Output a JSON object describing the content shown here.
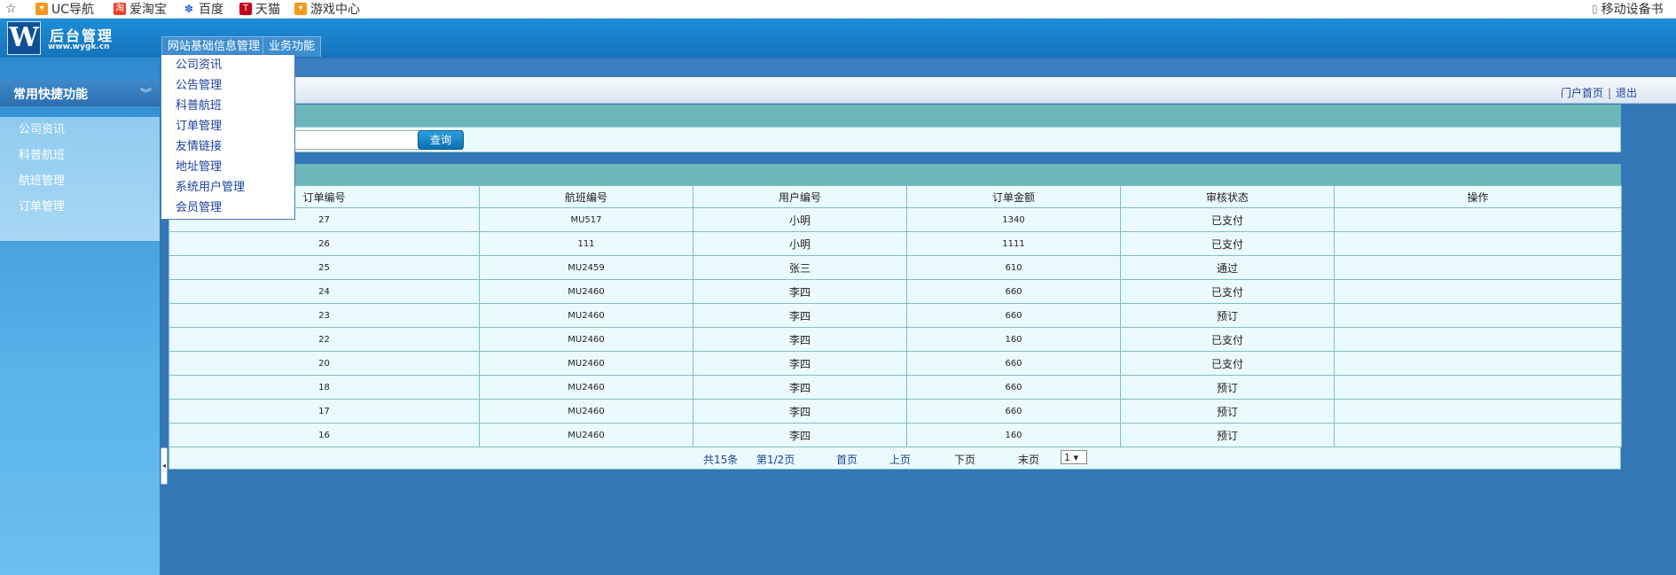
{
  "bookmarks": [
    {
      "label": "UC导航",
      "icon": "uc-icon",
      "color": "#f39a1e"
    },
    {
      "label": "爱淘宝",
      "icon": "taobao-icon",
      "color": "#e8412a"
    },
    {
      "label": "百度",
      "icon": "baidu-paw-icon",
      "color": "#2d6be0"
    },
    {
      "label": "天猫",
      "icon": "tmall-icon",
      "color": "#c4001a"
    },
    {
      "label": "游戏中心",
      "icon": "game-icon",
      "color": "#f39a1e"
    }
  ],
  "mobile_label": "移动设备书",
  "header": {
    "logo_letter": "W",
    "title": "后台管理",
    "url": "www.wygk.cn",
    "tabs": [
      "网站基础信息管理",
      "业务功能"
    ]
  },
  "dropdown": [
    "公司资讯",
    "公告管理",
    "科普航班",
    "订单管理",
    "友情链接",
    "地址管理",
    "系统用户管理",
    "会员管理"
  ],
  "sidebar": {
    "title": "常用快捷功能",
    "items": [
      "公司资讯",
      "科普航班",
      "航班管理",
      "订单管理"
    ]
  },
  "top_links": {
    "home": "门户首页",
    "sep": "|",
    "logout": "退出"
  },
  "search": {
    "button": "查询",
    "value": ""
  },
  "table": {
    "headers": [
      "订单编号",
      "航班编号",
      "用户编号",
      "订单金额",
      "审核状态",
      "操作"
    ],
    "rows": [
      [
        "27",
        "MU517",
        "小明",
        "1340",
        "已支付",
        ""
      ],
      [
        "26",
        "111",
        "小明",
        "1111",
        "已支付",
        ""
      ],
      [
        "25",
        "MU2459",
        "张三",
        "610",
        "通过",
        ""
      ],
      [
        "24",
        "MU2460",
        "李四",
        "660",
        "已支付",
        ""
      ],
      [
        "23",
        "MU2460",
        "李四",
        "660",
        "预订",
        ""
      ],
      [
        "22",
        "MU2460",
        "李四",
        "160",
        "已支付",
        ""
      ],
      [
        "20",
        "MU2460",
        "李四",
        "660",
        "已支付",
        ""
      ],
      [
        "18",
        "MU2460",
        "李四",
        "660",
        "预订",
        ""
      ],
      [
        "17",
        "MU2460",
        "李四",
        "660",
        "预订",
        ""
      ],
      [
        "16",
        "MU2460",
        "李四",
        "160",
        "预订",
        ""
      ]
    ]
  },
  "pager": {
    "total": "共15条",
    "page": "第1/2页",
    "first": "首页",
    "prev": "上页",
    "next": "下页",
    "last": "末页",
    "select_value": "1"
  }
}
